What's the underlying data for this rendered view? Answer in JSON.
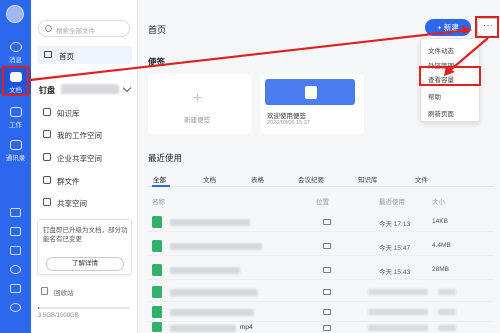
{
  "rail": {
    "items": [
      {
        "label": "消息",
        "icon": "chat-icon"
      },
      {
        "label": "文档",
        "icon": "document-icon"
      },
      {
        "label": "工作",
        "icon": "grid-icon"
      },
      {
        "label": "通讯录",
        "icon": "contacts-icon"
      }
    ],
    "active_index": 1
  },
  "sidebar": {
    "search_placeholder": "搜索全部文件",
    "home_label": "首页",
    "drive_label": "钉盘",
    "items": [
      {
        "label": "知识库",
        "icon": "book-icon"
      },
      {
        "label": "我的工作空间",
        "icon": "workspace-icon"
      },
      {
        "label": "企业共享空间",
        "icon": "enterprise-icon"
      },
      {
        "label": "群文件",
        "icon": "group-files-icon"
      },
      {
        "label": "共享空间",
        "icon": "shared-space-icon"
      }
    ],
    "promo_text": "钉盘即已升级为文档，部分功能名有已变更",
    "promo_button": "了解详情",
    "recycle_label": "回收站",
    "storage_text": "3.5GB/1000GB",
    "storage_fraction": 0.0035
  },
  "main": {
    "title": "首页",
    "new_button": "+ 新建",
    "more_button": "···",
    "notes_title": "便签",
    "new_note_label": "新建便签",
    "note_card": {
      "title": "欢迎使用便签",
      "date": "2020/03/06 15:37"
    },
    "recent_title": "最近使用",
    "tabs": [
      "全部",
      "文档",
      "表格",
      "会议纪要",
      "知识库",
      "文件"
    ],
    "active_tab": 0,
    "columns": {
      "name": "名称",
      "location": "位置",
      "last_used": "最近使用",
      "size": "大小"
    },
    "rows": [
      {
        "name": "",
        "time": "今天 17:13",
        "size": "14KB"
      },
      {
        "name": "",
        "time": "今天 15:47",
        "size": "4.4MB"
      },
      {
        "name": "",
        "time": "今天 15:43",
        "size": "28MB"
      },
      {
        "name": "",
        "time": "",
        "size": ""
      },
      {
        "name": "",
        "time": "",
        "size": ""
      },
      {
        "name": "mp4",
        "time": "",
        "size": ""
      }
    ]
  },
  "dropdown": {
    "items": [
      "文件动态",
      "外链管理",
      "查看容量",
      "帮助",
      "刷新页面"
    ],
    "highlighted_index": 2
  },
  "colors": {
    "accent": "#2c68ee",
    "annotation": "#e02020",
    "file_green": "#33b06b"
  }
}
